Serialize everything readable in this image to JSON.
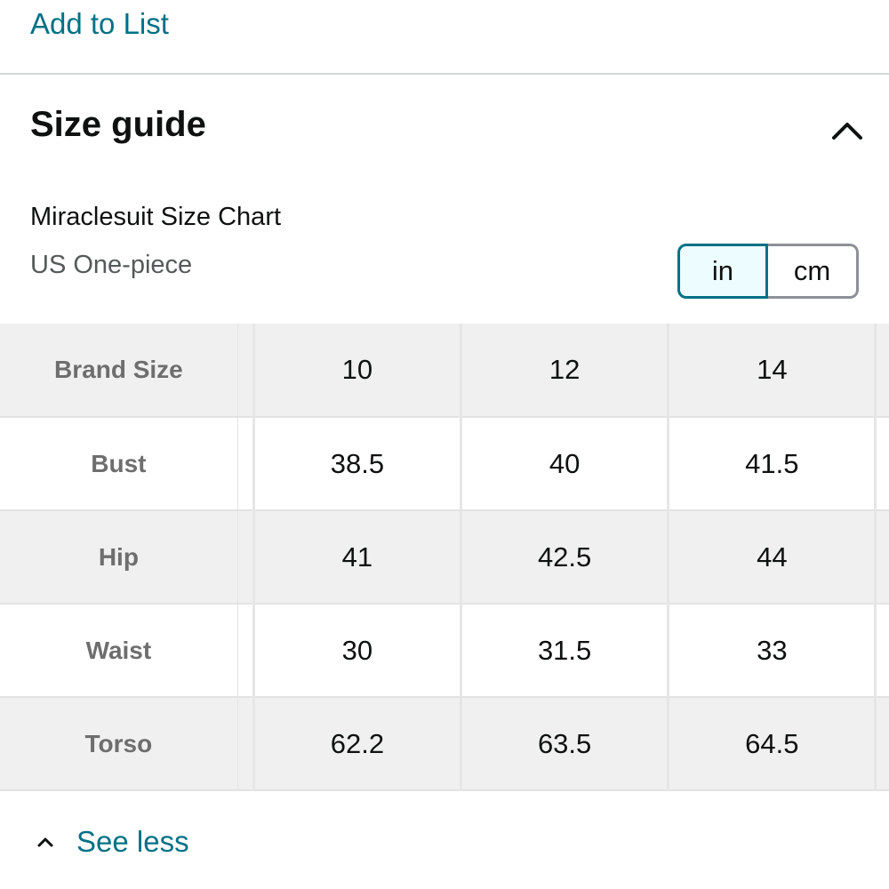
{
  "top_link": {
    "label": "Add to List"
  },
  "section": {
    "title": "Size guide",
    "collapse_icon": "chevron-up-icon"
  },
  "chart": {
    "name": "Miraclesuit Size Chart",
    "subtitle": "US One-piece",
    "units": {
      "selected": "in",
      "other": "cm"
    }
  },
  "table": {
    "rows": [
      {
        "label": "Brand Size",
        "values": [
          "10",
          "12",
          "14"
        ]
      },
      {
        "label": "Bust",
        "values": [
          "38.5",
          "40",
          "41.5"
        ]
      },
      {
        "label": "Hip",
        "values": [
          "41",
          "42.5",
          "44"
        ]
      },
      {
        "label": "Waist",
        "values": [
          "30",
          "31.5",
          "33"
        ]
      },
      {
        "label": "Torso",
        "values": [
          "62.2",
          "63.5",
          "64.5"
        ]
      }
    ]
  },
  "footer": {
    "see_less_label": "See less",
    "see_less_icon": "chevron-up-icon"
  },
  "colors": {
    "link": "#007185",
    "selected_border": "#007185",
    "selected_bg": "#edfdff",
    "row_shade": "#f0f0f0"
  }
}
